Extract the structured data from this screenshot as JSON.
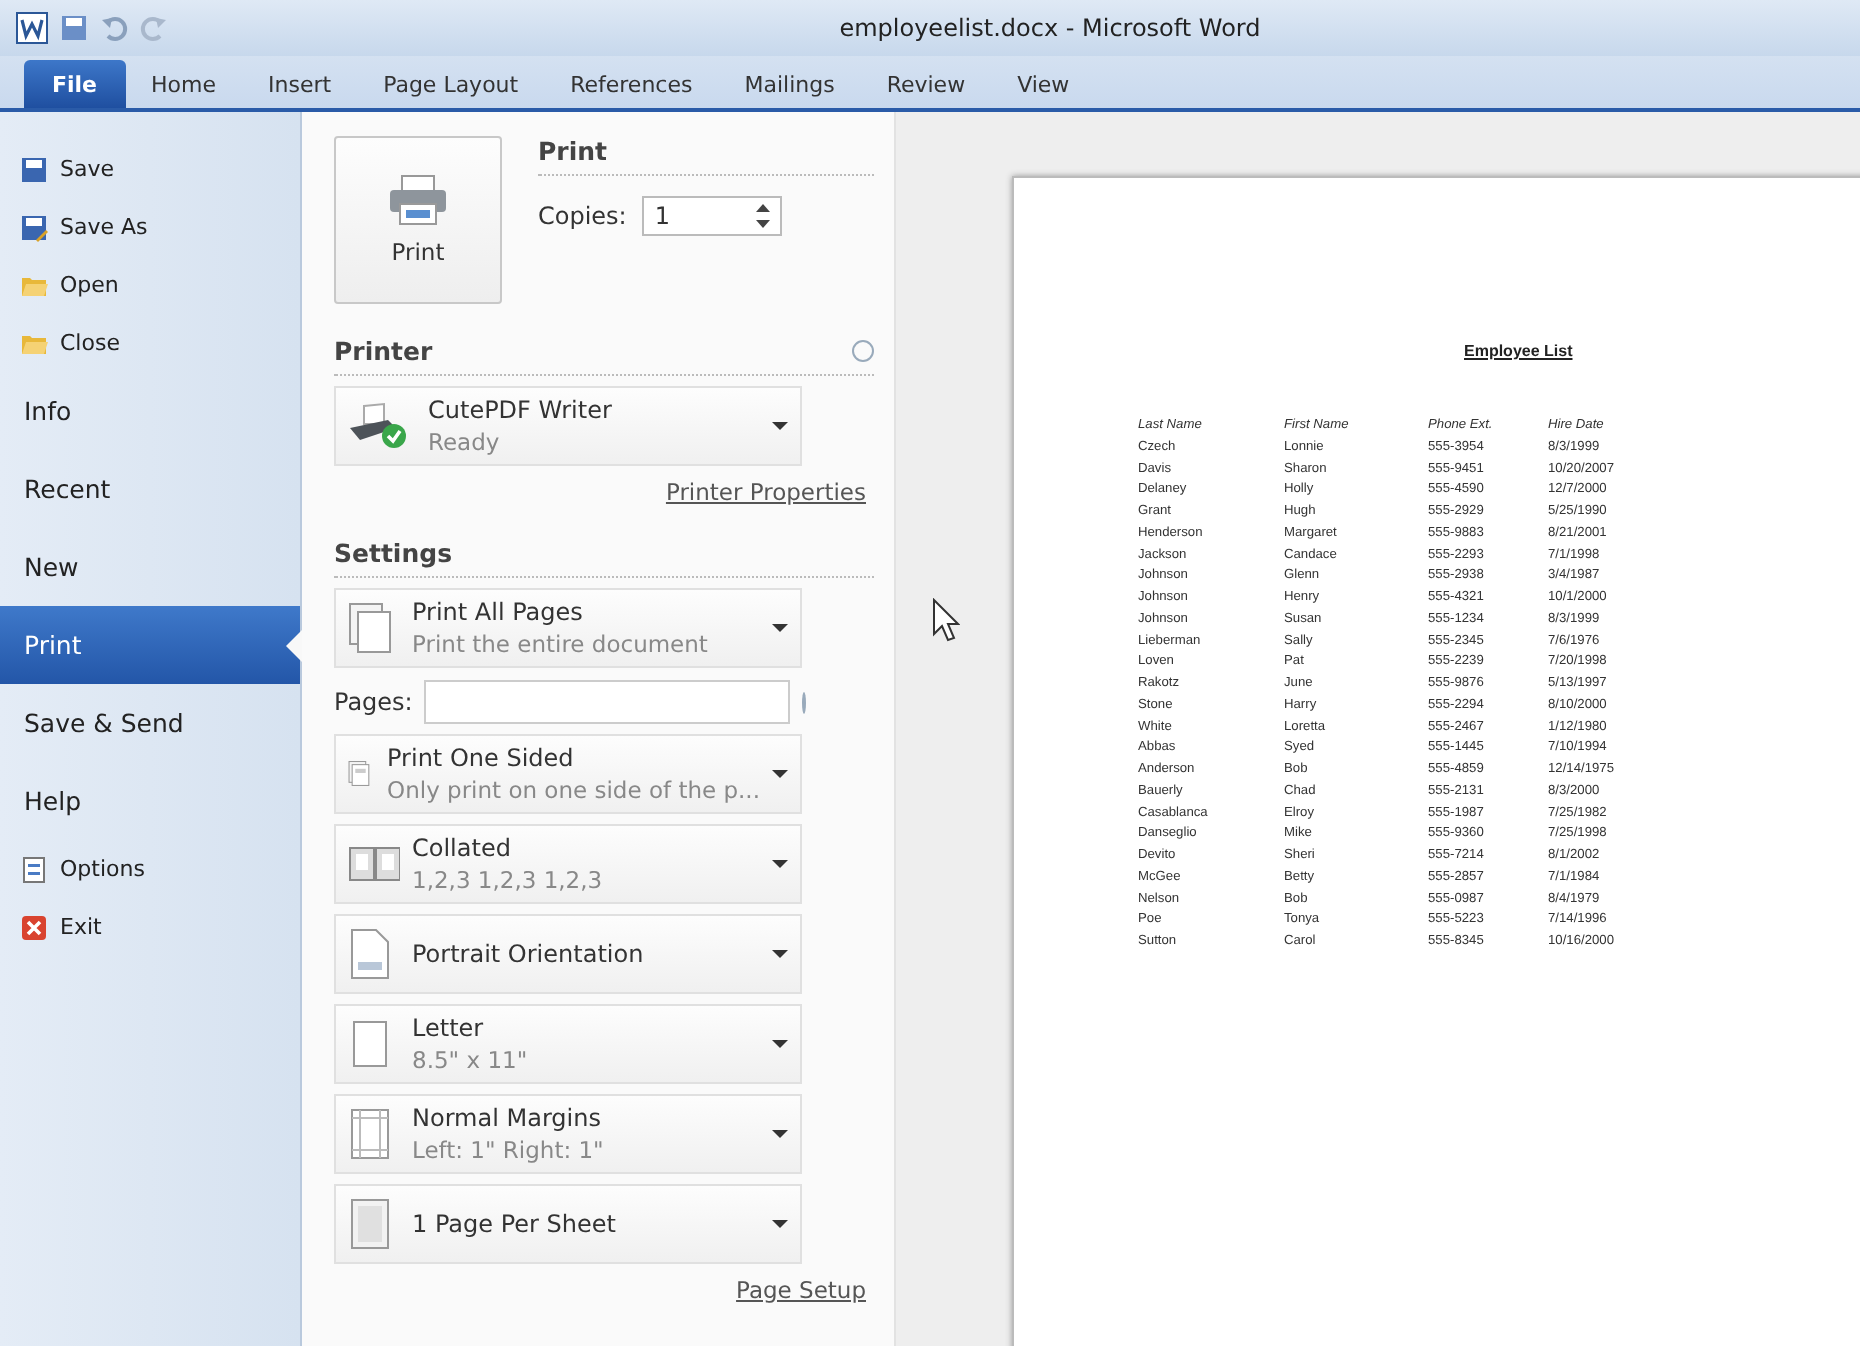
{
  "window": {
    "title": "employeelist.docx - Microsoft Word"
  },
  "ribbon_tabs": [
    {
      "label": "File",
      "selected": true
    },
    {
      "label": "Home",
      "selected": false
    },
    {
      "label": "Insert",
      "selected": false
    },
    {
      "label": "Page Layout",
      "selected": false
    },
    {
      "label": "References",
      "selected": false
    },
    {
      "label": "Mailings",
      "selected": false
    },
    {
      "label": "Review",
      "selected": false
    },
    {
      "label": "View",
      "selected": false
    }
  ],
  "sidebar": {
    "items": [
      {
        "label": "Save",
        "kind": "command",
        "selected": false
      },
      {
        "label": "Save As",
        "kind": "command",
        "selected": false
      },
      {
        "label": "Open",
        "kind": "command",
        "selected": false
      },
      {
        "label": "Close",
        "kind": "command",
        "selected": false
      },
      {
        "label": "Info",
        "kind": "page",
        "selected": false
      },
      {
        "label": "Recent",
        "kind": "page",
        "selected": false
      },
      {
        "label": "New",
        "kind": "page",
        "selected": false
      },
      {
        "label": "Print",
        "kind": "page",
        "selected": true
      },
      {
        "label": "Save & Send",
        "kind": "page",
        "selected": false
      },
      {
        "label": "Help",
        "kind": "page",
        "selected": false
      },
      {
        "label": "Options",
        "kind": "command",
        "selected": false
      },
      {
        "label": "Exit",
        "kind": "command",
        "selected": false
      }
    ]
  },
  "print": {
    "button": "Print",
    "heading": "Print",
    "copies_label": "Copies:",
    "copies": "1"
  },
  "printer": {
    "heading": "Printer",
    "name": "CutePDF Writer",
    "status": "Ready",
    "properties_link": "Printer Properties"
  },
  "settings": {
    "heading": "Settings",
    "pages_label": "Pages:",
    "options": [
      {
        "title": "Print All Pages",
        "subtitle": "Print the entire document"
      },
      {
        "title": "Print One Sided",
        "subtitle": "Only print on one side of the p..."
      },
      {
        "title": "Collated",
        "subtitle": "1,2,3   1,2,3   1,2,3"
      },
      {
        "title": "Portrait Orientation"
      },
      {
        "title": "Letter",
        "subtitle": "8.5\" x 11\""
      },
      {
        "title": "Normal Margins",
        "subtitle": "Left: 1\"   Right: 1\""
      },
      {
        "title": "1 Page Per Sheet"
      }
    ],
    "page_setup_link": "Page Setup"
  },
  "preview": {
    "title": "Employee List",
    "columns": [
      "Last Name",
      "First Name",
      "Phone Ext.",
      "Hire Date"
    ],
    "rows": [
      [
        "Czech",
        "Lonnie",
        "555-3954",
        "8/3/1999"
      ],
      [
        "Davis",
        "Sharon",
        "555-9451",
        "10/20/2007"
      ],
      [
        "Delaney",
        "Holly",
        "555-4590",
        "12/7/2000"
      ],
      [
        "Grant",
        "Hugh",
        "555-2929",
        "5/25/1990"
      ],
      [
        "Henderson",
        "Margaret",
        "555-9883",
        "8/21/2001"
      ],
      [
        "Jackson",
        "Candace",
        "555-2293",
        "7/1/1998"
      ],
      [
        "Johnson",
        "Glenn",
        "555-2938",
        "3/4/1987"
      ],
      [
        "Johnson",
        "Henry",
        "555-4321",
        "10/1/2000"
      ],
      [
        "Johnson",
        "Susan",
        "555-1234",
        "8/3/1999"
      ],
      [
        "Lieberman",
        "Sally",
        "555-2345",
        "7/6/1976"
      ],
      [
        "Loven",
        "Pat",
        "555-2239",
        "7/20/1998"
      ],
      [
        "Rakotz",
        "June",
        "555-9876",
        "5/13/1997"
      ],
      [
        "Stone",
        "Harry",
        "555-2294",
        "8/10/2000"
      ],
      [
        "White",
        "Loretta",
        "555-2467",
        "1/12/1980"
      ],
      [
        "Abbas",
        "Syed",
        "555-1445",
        "7/10/1994"
      ],
      [
        "Anderson",
        "Bob",
        "555-4859",
        "12/14/1975"
      ],
      [
        "Bauerly",
        "Chad",
        "555-2131",
        "8/3/2000"
      ],
      [
        "Casablanca",
        "Elroy",
        "555-1987",
        "7/25/1982"
      ],
      [
        "Danseglio",
        "Mike",
        "555-9360",
        "7/25/1998"
      ],
      [
        "Devito",
        "Sheri",
        "555-7214",
        "8/1/2002"
      ],
      [
        "McGee",
        "Betty",
        "555-2857",
        "7/1/1984"
      ],
      [
        "Nelson",
        "Bob",
        "555-0987",
        "8/4/1979"
      ],
      [
        "Poe",
        "Tonya",
        "555-5223",
        "7/14/1996"
      ],
      [
        "Sutton",
        "Carol",
        "555-8345",
        "10/16/2000"
      ]
    ]
  }
}
